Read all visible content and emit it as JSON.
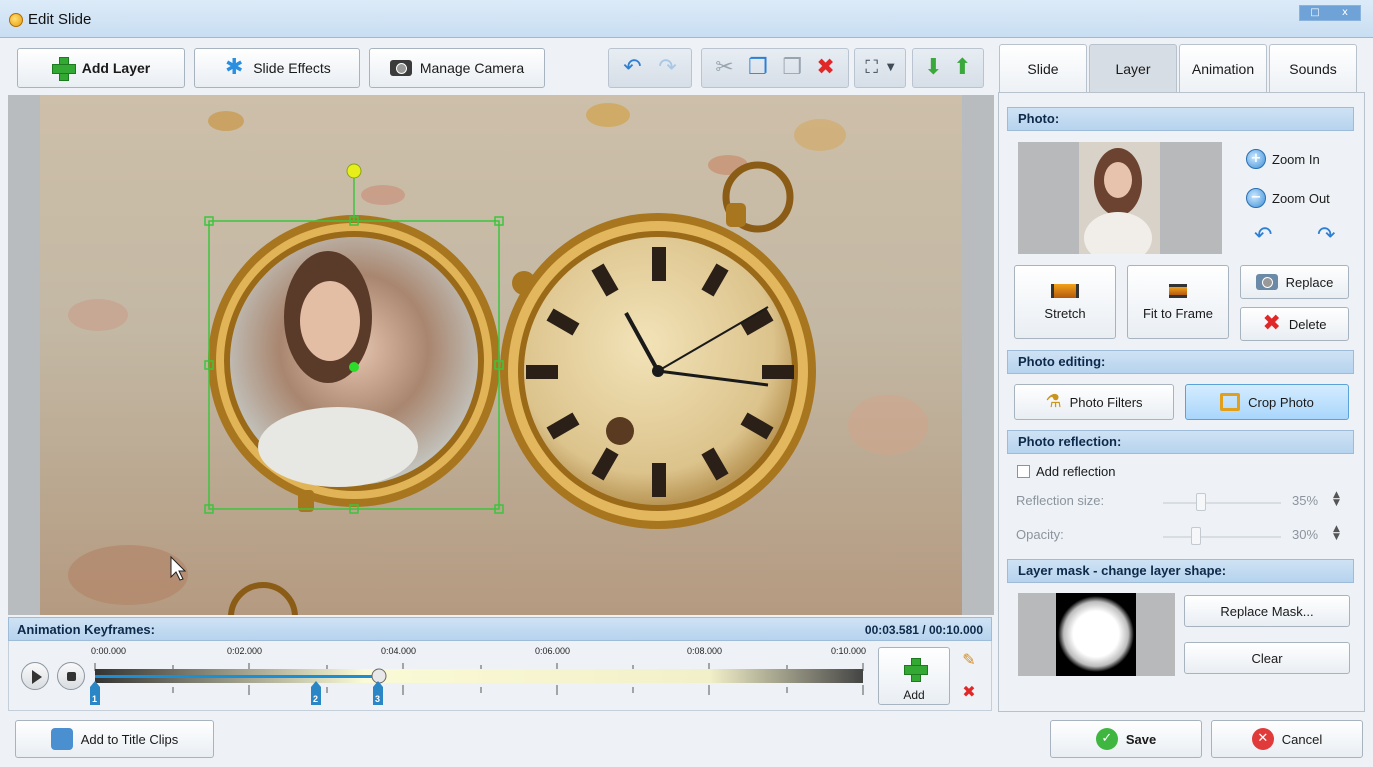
{
  "window": {
    "title": "Edit Slide",
    "controls": [
      "□",
      "x"
    ]
  },
  "toolbar": {
    "add_layer": "Add Layer",
    "slide_effects": "Slide Effects",
    "manage_camera": "Manage Camera",
    "icons": [
      "undo-icon",
      "redo-icon",
      "cut-icon",
      "copy-icon",
      "paste-icon",
      "delete-icon",
      "fit-icon",
      "move-down-icon",
      "move-up-icon"
    ]
  },
  "keyframes": {
    "header": "Animation Keyframes:",
    "time": "00:03.581 / 00:10.000",
    "ticks": [
      "0:00.000",
      "0:02.000",
      "0:04.000",
      "0:06.000",
      "0:08.000",
      "0:10.000"
    ],
    "markers": [
      "1",
      "2",
      "3"
    ],
    "add_label": "Add"
  },
  "bottom": {
    "add_to_title_clips": "Add to Title Clips",
    "save": "Save",
    "cancel": "Cancel"
  },
  "tabs": [
    "Slide",
    "Layer",
    "Animation",
    "Sounds"
  ],
  "active_tab": "Layer",
  "panel": {
    "photo_header": "Photo:",
    "zoom_in": "Zoom In",
    "zoom_out": "Zoom Out",
    "stretch": "Stretch",
    "fit_to_frame": "Fit to Frame",
    "replace": "Replace",
    "delete": "Delete",
    "photo_editing_header": "Photo editing:",
    "photo_filters": "Photo Filters",
    "crop_photo": "Crop Photo",
    "reflection_header": "Photo reflection:",
    "add_reflection": "Add reflection",
    "reflection_size_label": "Reflection size:",
    "reflection_size_value": "35%",
    "opacity_label": "Opacity:",
    "opacity_value": "30%",
    "mask_header": "Layer mask - change layer shape:",
    "replace_mask": "Replace Mask...",
    "clear": "Clear"
  },
  "colors": {
    "accent": "#2d7fd3",
    "header_bg": "#c3dbf1",
    "save_green": "#3fb63f",
    "cancel_red": "#e03a3a"
  }
}
